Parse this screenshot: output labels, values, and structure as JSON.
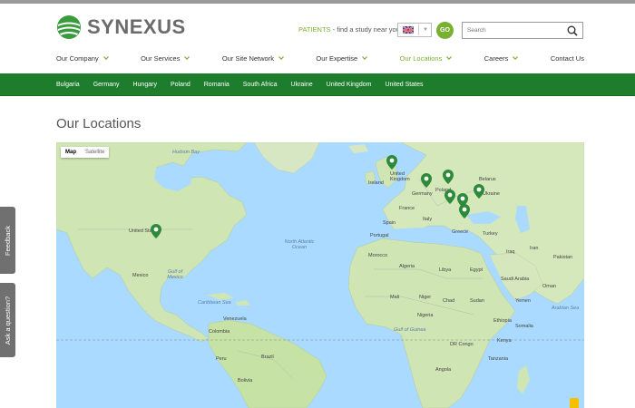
{
  "brand": {
    "name": "SYNEXUS"
  },
  "header": {
    "patients_label": "PATIENTS",
    "patients_text": "- find a study near you",
    "go_label": "GO",
    "search_placeholder": "Search"
  },
  "nav": [
    {
      "label": "Our Company",
      "chevron": true
    },
    {
      "label": "Our Services",
      "chevron": true
    },
    {
      "label": "Our Site Network",
      "chevron": true
    },
    {
      "label": "Our Expertise",
      "chevron": true
    },
    {
      "label": "Our Locations",
      "chevron": true,
      "active": true
    },
    {
      "label": "Careers",
      "chevron": true
    },
    {
      "label": "Contact Us",
      "chevron": false
    }
  ],
  "countries": [
    "Bulgaria",
    "Germany",
    "Hungary",
    "Poland",
    "Romania",
    "South Africa",
    "Ukraine",
    "United Kingdom",
    "United States"
  ],
  "page": {
    "title": "Our Locations"
  },
  "map": {
    "type_map": "Map",
    "type_satellite": "Satellite",
    "labels": {
      "hudson_bay": "Hudson Bay",
      "united_states": "United States",
      "mexico": "Mexico",
      "gulf_of_mexico": "Gulf of Mexico",
      "caribbean_sea": "Caribbean Sea",
      "north_atlantic": "North Atlantic Ocean",
      "venezuela": "Venezuela",
      "colombia": "Colombia",
      "peru": "Peru",
      "brazil": "Brazil",
      "bolivia": "Bolivia",
      "united_kingdom": "United Kingdom",
      "ireland": "Ireland",
      "germany": "Germany",
      "france": "France",
      "spain": "Spain",
      "portugal": "Portugal",
      "italy": "Italy",
      "poland": "Poland",
      "ukraine": "Ukraine",
      "belarus": "Belarus",
      "greece": "Greece",
      "turkey": "Turkey",
      "morocco": "Morocco",
      "algeria": "Algeria",
      "libya": "Libya",
      "egypt": "Egypt",
      "mali": "Mali",
      "niger": "Niger",
      "chad": "Chad",
      "sudan": "Sudan",
      "nigeria": "Nigeria",
      "ethiopia": "Ethiopia",
      "saudi_arabia": "Saudi Arabia",
      "iraq": "Iraq",
      "iran": "Iran",
      "kenya": "Kenya",
      "tanzania": "Tanzania",
      "angola": "Angola",
      "dr_congo": "DR Congo",
      "gulf_of_guinea": "Gulf of Guinea",
      "arabian_sea": "Arabian Sea",
      "yemen": "Yemen",
      "somalia": "Somalia",
      "oman": "Oman",
      "pakistan": "Pakistan"
    }
  },
  "side": {
    "feedback": "Feedback",
    "question": "Ask a question?"
  },
  "colors": {
    "accent": "#7ab032",
    "nav_green": "#1e7d2d",
    "water": "#aadaff",
    "land": "#cfe5b4"
  }
}
